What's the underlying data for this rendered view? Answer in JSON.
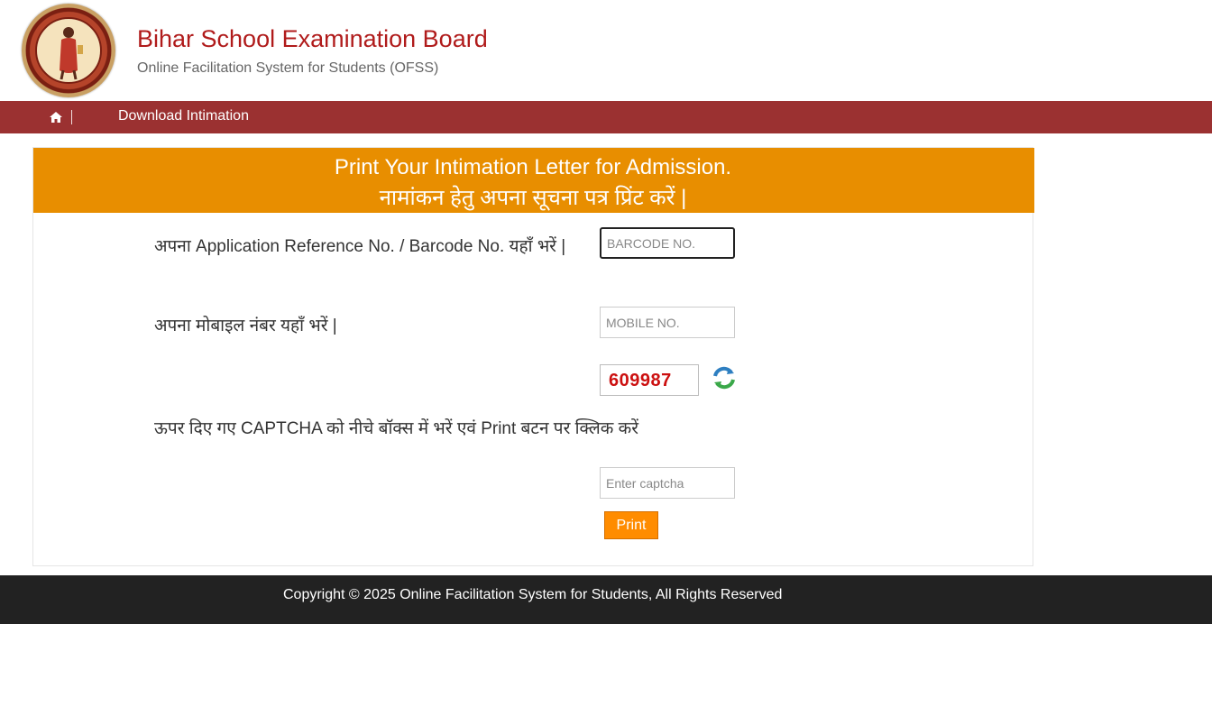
{
  "header": {
    "title": "Bihar School Examination Board",
    "subtitle": "Online Facilitation System for Students (OFSS)",
    "logo_icon": "bseb-seal-logo"
  },
  "nav": {
    "home_icon": "home-icon",
    "items": [
      {
        "label": "Download Intimation"
      }
    ]
  },
  "panel": {
    "heading_en": "Print Your Intimation Letter for Admission.",
    "heading_hi": "नामांकन हेतु अपना सूचना पत्र प्रिंट करें |",
    "barcode_label": "अपना Application Reference No. / Barcode No. यहाँ भरें |",
    "barcode_placeholder": "BARCODE NO.",
    "barcode_value": "",
    "mobile_label": "अपना मोबाइल नंबर यहाँ भरें |",
    "mobile_placeholder": "MOBILE NO.",
    "mobile_value": "",
    "captcha_code": "609987",
    "refresh_icon": "refresh-icon",
    "captcha_instruction": "ऊपर दिए गए CAPTCHA को नीचे बॉक्स में भरें एवं Print बटन पर क्लिक करें",
    "captcha_placeholder": "Enter captcha",
    "captcha_value": "",
    "print_label": "Print"
  },
  "footer": {
    "copyright": "Copyright © 2025 Online Facilitation System for Students, All Rights Reserved"
  },
  "colors": {
    "title_red": "#b01b1b",
    "nav_bg": "#9b3131",
    "panel_head_bg": "#e88e00",
    "print_btn_bg": "#ff8c00",
    "captcha_text": "#cc1010",
    "footer_bg": "#222222"
  }
}
